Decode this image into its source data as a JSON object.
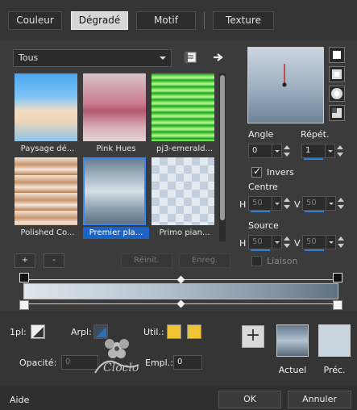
{
  "tabs": [
    {
      "label": "Couleur"
    },
    {
      "label": "Dégradé"
    },
    {
      "label": "Motif"
    },
    {
      "label": "Texture"
    }
  ],
  "presets": {
    "category": "Tous",
    "items": [
      {
        "label": "Paysage dé..."
      },
      {
        "label": "Pink Hues"
      },
      {
        "label": "pj3-emerald..."
      },
      {
        "label": "Polished Co..."
      },
      {
        "label": "Premier pla..."
      },
      {
        "label": "Primo pian..."
      }
    ],
    "buttons": {
      "add": "+",
      "remove": "-",
      "reset": "Réinit.",
      "save": "Enreg."
    }
  },
  "settings": {
    "angle_label": "Angle",
    "angle_value": "0",
    "repeat_label": "Répét.",
    "repeat_value": "1",
    "invert_label": "Invers",
    "invert_checked": true,
    "center_label": "Centre",
    "center_h_label": "H",
    "center_h_value": "50",
    "center_v_label": "V",
    "center_v_value": "50",
    "source_label": "Source",
    "source_h_label": "H",
    "source_h_value": "50",
    "source_v_label": "V",
    "source_v_value": "50",
    "link_label": "Liaison"
  },
  "stop_controls": {
    "opacity_label": "1pl:",
    "arpl_label": "Arpl:",
    "util_label": "Util.:",
    "opacite_label": "Opacité:",
    "opacite_value": "0",
    "empl_label": "Empl.:",
    "empl_value": "0",
    "util_color": "#f1c232"
  },
  "current": {
    "actual_label": "Actuel",
    "previous_label": "Préc."
  },
  "footer": {
    "help": "Aide",
    "ok": "OK",
    "cancel": "Annuler"
  },
  "watermark": "Cloclo"
}
